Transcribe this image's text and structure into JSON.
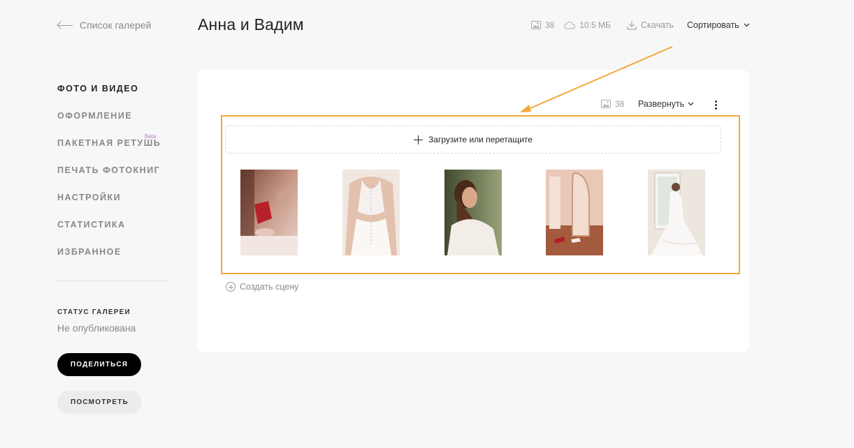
{
  "header": {
    "back_label": "Список галерей",
    "title": "Анна и Вадим",
    "photo_count": "38",
    "storage_size": "10.5 МБ",
    "download_label": "Скачать",
    "sort_label": "Сортировать"
  },
  "sidebar": {
    "items": [
      {
        "label": "ФОТО И ВИДЕО",
        "active": true
      },
      {
        "label": "ОФОРМЛЕНИЕ"
      },
      {
        "label": "ПАКЕТНАЯ РЕТУШЬ",
        "badge": "Beta"
      },
      {
        "label": "ПЕЧАТЬ ФОТОКНИГ"
      },
      {
        "label": "НАСТРОЙКИ"
      },
      {
        "label": "СТАТИСТИКА"
      },
      {
        "label": "ИЗБРАННОЕ"
      }
    ],
    "status_heading": "СТАТУС ГАЛЕРЕИ",
    "status_value": "Не опубликована",
    "share_label": "ПОДЕЛИТЬСЯ",
    "view_label": "ПОСМОТРЕТЬ"
  },
  "scene": {
    "photo_count": "38",
    "expand_label": "Развернуть",
    "upload_label": "Загрузите или перетащите",
    "create_scene_label": "Создать сцену"
  },
  "colors": {
    "highlight": "#f0a93a",
    "background": "#f7f7f7",
    "accent_dark": "#000000",
    "beta": "#b07cc6"
  },
  "icons": [
    "image-icon",
    "cloud-icon",
    "download-icon",
    "chevron-down-icon",
    "kebab-icon",
    "plus-icon",
    "circle-plus-icon",
    "back-arrow-icon"
  ]
}
